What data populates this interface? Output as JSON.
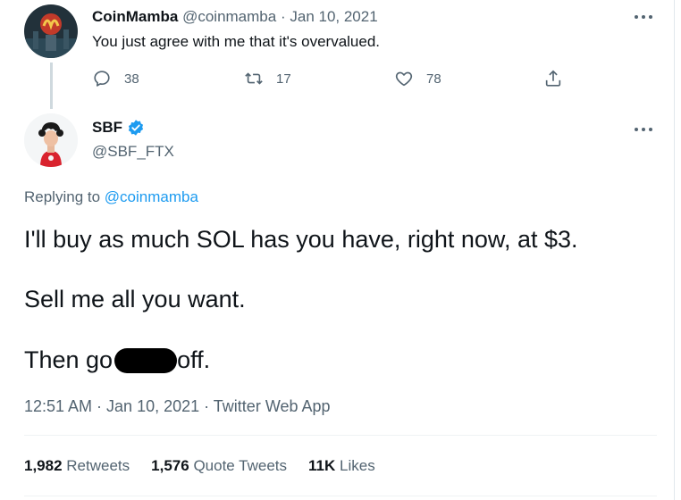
{
  "parent_tweet": {
    "name": "CoinMamba",
    "handle": "@coinmamba",
    "separator": "·",
    "date": "Jan 10, 2021",
    "text": "You just agree with me that it's overvalued.",
    "actions": {
      "reply_count": "38",
      "retweet_count": "17",
      "like_count": "78"
    },
    "avatar_icon": "coinmamba-avatar",
    "more_icon": "more-horizontal-icon"
  },
  "main_tweet": {
    "name": "SBF",
    "handle": "@SBF_FTX",
    "verified_icon": "verified-badge-icon",
    "replying_prefix": "Replying to",
    "replying_mention": "@coinmamba",
    "lines": {
      "line1": "I'll buy as much SOL has you have, right now, at $3.",
      "line2": "Sell me all you want.",
      "line3_before": "Then go",
      "line3_after": "off."
    },
    "meta": "12:51 AM · Jan 10, 2021 · Twitter Web App",
    "stats": {
      "retweets_count": "1,982",
      "retweets_label": "Retweets",
      "quotes_count": "1,576",
      "quotes_label": "Quote Tweets",
      "likes_count": "11K",
      "likes_label": "Likes"
    }
  },
  "colors": {
    "text": "#0f1419",
    "secondary": "#536471",
    "link": "#1d9bf0",
    "verified": "#1d9bf0",
    "divider": "#eff3f4"
  }
}
